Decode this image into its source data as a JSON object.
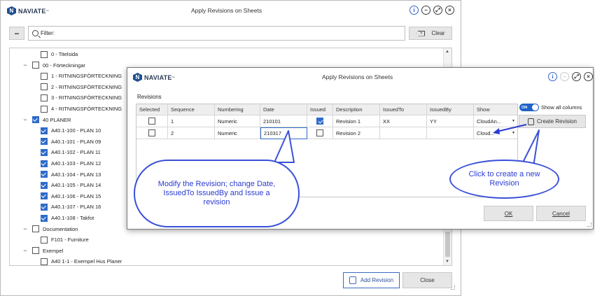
{
  "brand": "NAVIATE",
  "main": {
    "title": "Apply Revisions on Sheets",
    "filter_placeholder": "Filter:",
    "clear_label": "Clear",
    "collapse_label": "−",
    "add_revision_label": "Add Revision",
    "close_label": "Close",
    "tree": [
      {
        "label": "0 - Titelsida",
        "level": 1,
        "checked": false,
        "expander": ""
      },
      {
        "label": "00 - Förteckningar",
        "level": 0,
        "checked": false,
        "expander": "−"
      },
      {
        "label": "1 - RITNINGSFÖRTECKNING",
        "level": 1,
        "checked": false,
        "expander": ""
      },
      {
        "label": "2 - RITNINGSFÖRTECKNING",
        "level": 1,
        "checked": false,
        "expander": ""
      },
      {
        "label": "3 - RITNINGSFÖRTECKNING",
        "level": 1,
        "checked": false,
        "expander": ""
      },
      {
        "label": "4 - RITNINGSFÖRTECKNING",
        "level": 1,
        "checked": false,
        "expander": ""
      },
      {
        "label": "40 PLANER",
        "level": 0,
        "checked": true,
        "expander": "−"
      },
      {
        "label": "A40.1-100 - PLAN 10",
        "level": 1,
        "checked": true,
        "expander": ""
      },
      {
        "label": "A40.1-101 - PLAN 09",
        "level": 1,
        "checked": true,
        "expander": ""
      },
      {
        "label": "A40.1-102 - PLAN 11",
        "level": 1,
        "checked": true,
        "expander": ""
      },
      {
        "label": "A40.1-103 - PLAN 12",
        "level": 1,
        "checked": true,
        "expander": ""
      },
      {
        "label": "A40.1-104 - PLAN 13",
        "level": 1,
        "checked": true,
        "expander": ""
      },
      {
        "label": "A40.1-105 - PLAN 14",
        "level": 1,
        "checked": true,
        "expander": ""
      },
      {
        "label": "A40.1-106 - PLAN 15",
        "level": 1,
        "checked": true,
        "expander": ""
      },
      {
        "label": "A40.1-107 - PLAN 16",
        "level": 1,
        "checked": true,
        "expander": ""
      },
      {
        "label": "A40.1-108 - Takfot",
        "level": 1,
        "checked": true,
        "expander": ""
      },
      {
        "label": "Documentation",
        "level": 0,
        "checked": false,
        "expander": "−"
      },
      {
        "label": "F101 - Furniture",
        "level": 1,
        "checked": false,
        "expander": ""
      },
      {
        "label": "Exempel",
        "level": 0,
        "checked": false,
        "expander": "−"
      },
      {
        "label": "A40 1-1 - Exempel Hus Planer",
        "level": 1,
        "checked": false,
        "expander": ""
      }
    ]
  },
  "revisions_dialog": {
    "title": "Apply Revisions on Sheets",
    "section_label": "Revisions",
    "show_all_columns_label": "Show all columns",
    "toggle_label": "ON",
    "toggle_on": true,
    "create_revision_label": "Create Revision",
    "ok_label": "OK",
    "cancel_label": "Cancel",
    "columns": [
      "Selected",
      "Sequence",
      "Numbering",
      "Date",
      "Issued",
      "Description",
      "IssuedTo",
      "IssuedBy",
      "Show"
    ],
    "rows": [
      {
        "selected": false,
        "sequence": "1",
        "numbering": "Numeric",
        "date": "210101",
        "issued": true,
        "description": "Revision 1",
        "issued_to": "XX",
        "issued_by": "YY",
        "show": "CloudAn..."
      },
      {
        "selected": false,
        "sequence": "2",
        "numbering": "Numeric",
        "date": "210317",
        "issued": false,
        "description": "Revision 2",
        "issued_to": "",
        "issued_by": "",
        "show": "Cloud..."
      }
    ]
  },
  "callouts": {
    "modify": "Modify the Revision; change Date, IssuedTo IssuedBy and Issue a revision",
    "create": "Click to create a new Revision"
  },
  "colors": {
    "accent": "#2f6bc8",
    "callout": "#3a50d8",
    "brand": "#1e4f8f"
  }
}
